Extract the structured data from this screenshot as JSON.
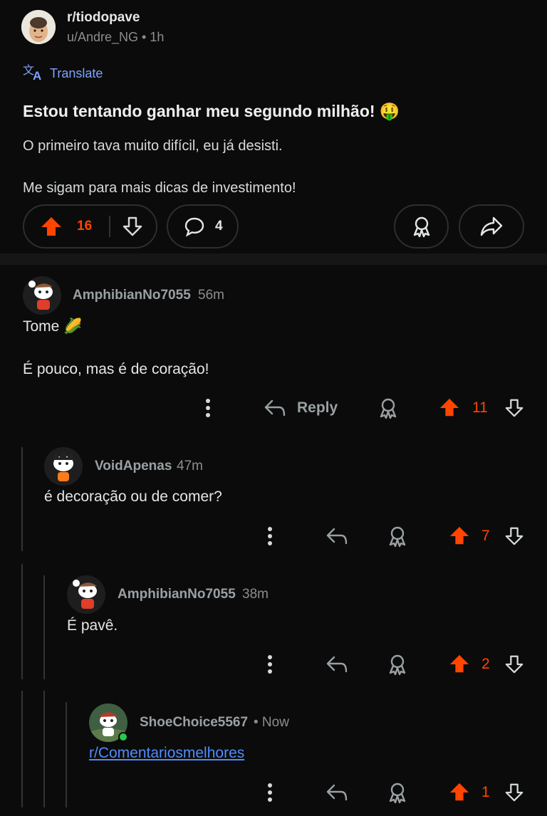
{
  "post": {
    "subreddit": "r/tiodopave",
    "author_meta": "u/Andre_NG • 1h",
    "translate_label": "Translate",
    "title": "Estou tentando ganhar meu segundo milhão! 🤑",
    "body_line1": "O primeiro tava muito difícil, eu já desisti.",
    "body_line2": "Me sigam para mais dicas de investimento!",
    "upvotes": "16",
    "comments": "4"
  },
  "comments": [
    {
      "author": "AmphibianNo7055",
      "time": "56m",
      "line1": "Tome 🌽",
      "line2": "É pouco, mas é de coração!",
      "reply_label": "Reply",
      "votes": "11"
    },
    {
      "author": "VoidApenas",
      "time": "47m",
      "line1": "é decoração ou de comer?",
      "votes": "7"
    },
    {
      "author": "AmphibianNo7055",
      "time": "38m",
      "line1": "É pavê.",
      "votes": "2"
    },
    {
      "author": "ShoeChoice5567",
      "time": "• Now",
      "line1": "r/Comentariosmelhores",
      "votes": "1"
    }
  ],
  "colors": {
    "upvote": "#ff4500",
    "link": "#4f8cff",
    "translate": "#7ea4ff",
    "online": "#26c94f"
  }
}
